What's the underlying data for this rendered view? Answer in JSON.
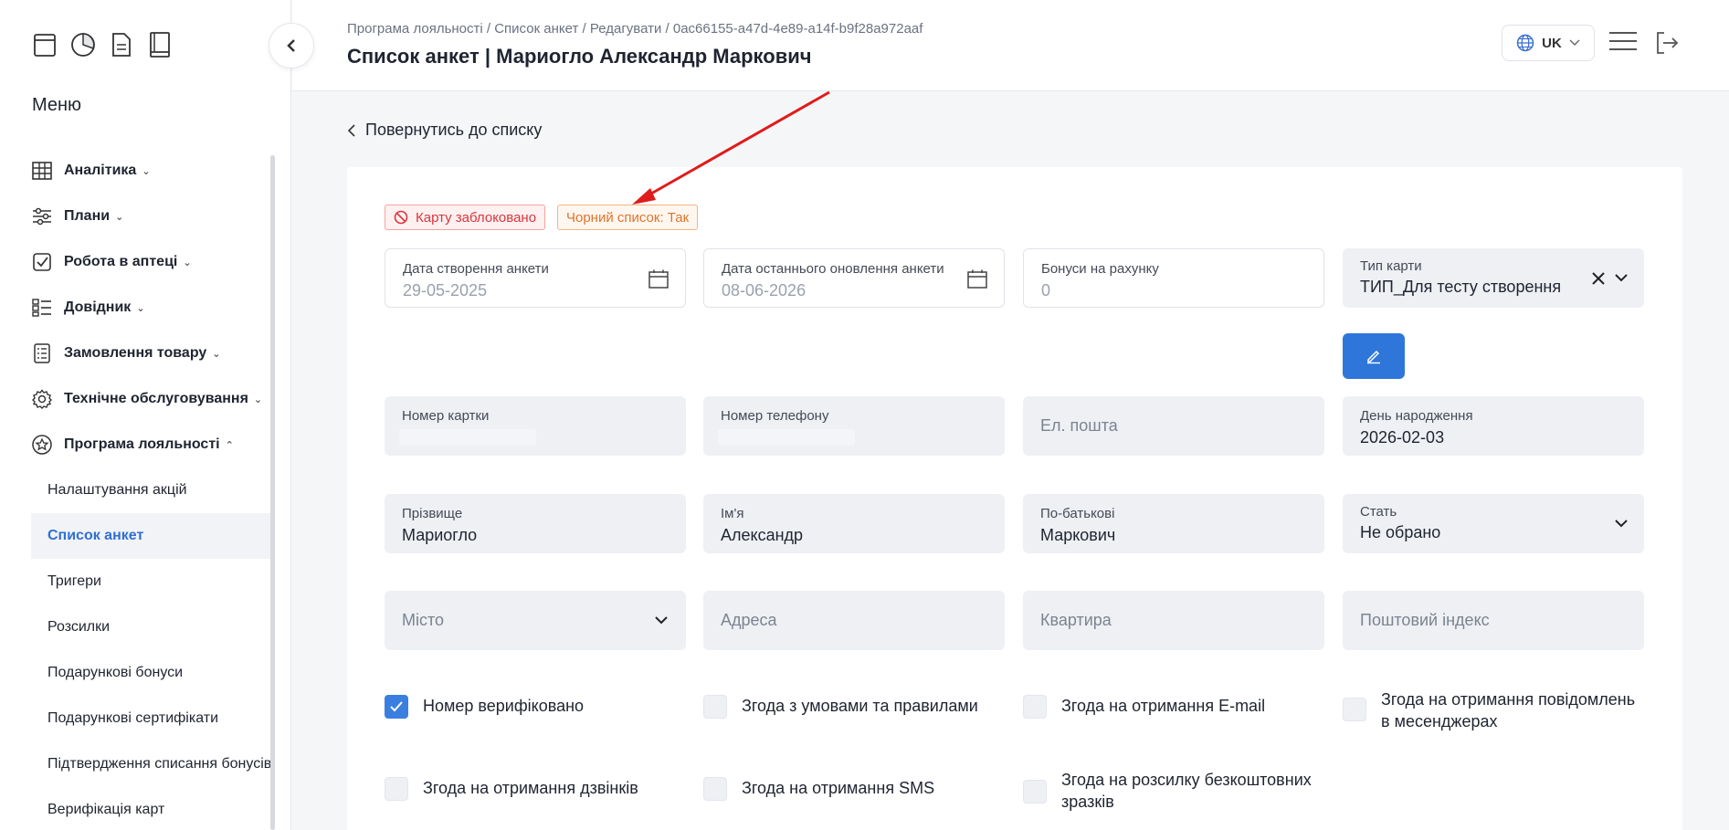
{
  "sidebar": {
    "menu_title": "Меню",
    "items": [
      {
        "label": "Аналітика",
        "icon": "table-icon"
      },
      {
        "label": "Плани",
        "icon": "sliders-icon"
      },
      {
        "label": "Робота в аптеці",
        "icon": "check-square-icon"
      },
      {
        "label": "Довідник",
        "icon": "list-icon"
      },
      {
        "label": "Замовлення товару",
        "icon": "clipboard-icon"
      },
      {
        "label": "Технічне обслуговування",
        "icon": "gear-icon"
      },
      {
        "label": "Програма лояльності",
        "icon": "star-icon"
      }
    ],
    "sub_items": [
      {
        "label": "Налаштування акцій"
      },
      {
        "label": "Список анкет"
      },
      {
        "label": "Тригери"
      },
      {
        "label": "Розсилки"
      },
      {
        "label": "Подарункові бонуси"
      },
      {
        "label": "Подарункові сертифікати"
      },
      {
        "label": "Підтвердження списання бонусів"
      },
      {
        "label": "Верифікація карт"
      }
    ]
  },
  "header": {
    "breadcrumb": "Програма лояльності / Список анкет / Редагувати / 0ac66155-a47d-4e89-a14f-b9f28a972aaf",
    "title": "Список анкет | Мариогло Александр Маркович",
    "lang": "UK"
  },
  "back_label": "Повернутись до списку",
  "badges": {
    "blocked": "Карту заблоковано",
    "blacklist": "Чорний список: Так"
  },
  "fields": {
    "created": {
      "label": "Дата створення анкети",
      "value": "29-05-2025"
    },
    "updated": {
      "label": "Дата останнього оновлення анкети",
      "value": "08-06-2026"
    },
    "bonuses": {
      "label": "Бонуси на рахунку",
      "value": "0"
    },
    "card_type": {
      "label": "Тип карти",
      "value": "ТИП_Для тесту створення"
    },
    "card_number": {
      "label": "Номер картки"
    },
    "phone": {
      "label": "Номер телефону"
    },
    "email": {
      "placeholder": "Ел. пошта"
    },
    "birthday": {
      "label": "День народження",
      "value": "2026-02-03"
    },
    "last_name": {
      "label": "Прізвище",
      "value": "Мариогло"
    },
    "first_name": {
      "label": "Ім'я",
      "value": "Александр"
    },
    "middle_name": {
      "label": "По-батькові",
      "value": "Маркович"
    },
    "gender": {
      "label": "Стать",
      "value": "Не обрано"
    },
    "city": {
      "placeholder": "Місто"
    },
    "address": {
      "placeholder": "Адреса"
    },
    "apartment": {
      "placeholder": "Квартира"
    },
    "postal": {
      "placeholder": "Поштовий індекс"
    }
  },
  "checkboxes": [
    {
      "label": "Номер верифіковано",
      "checked": true
    },
    {
      "label": "Згода з умовами та правилами",
      "checked": false
    },
    {
      "label": "Згода на отримання E-mail",
      "checked": false
    },
    {
      "label": "Згода на отримання повідомлень в месенджерах",
      "checked": false
    },
    {
      "label": "Згода на отримання дзвінків",
      "checked": false
    },
    {
      "label": "Згода на отримання SMS",
      "checked": false
    },
    {
      "label": "Згода на розсилку безкоштовних зразків",
      "checked": false
    }
  ],
  "colors": {
    "accent": "#2f76db",
    "danger": "#d9363e",
    "warning": "#e0742c",
    "annotation": "#e01b1b"
  }
}
